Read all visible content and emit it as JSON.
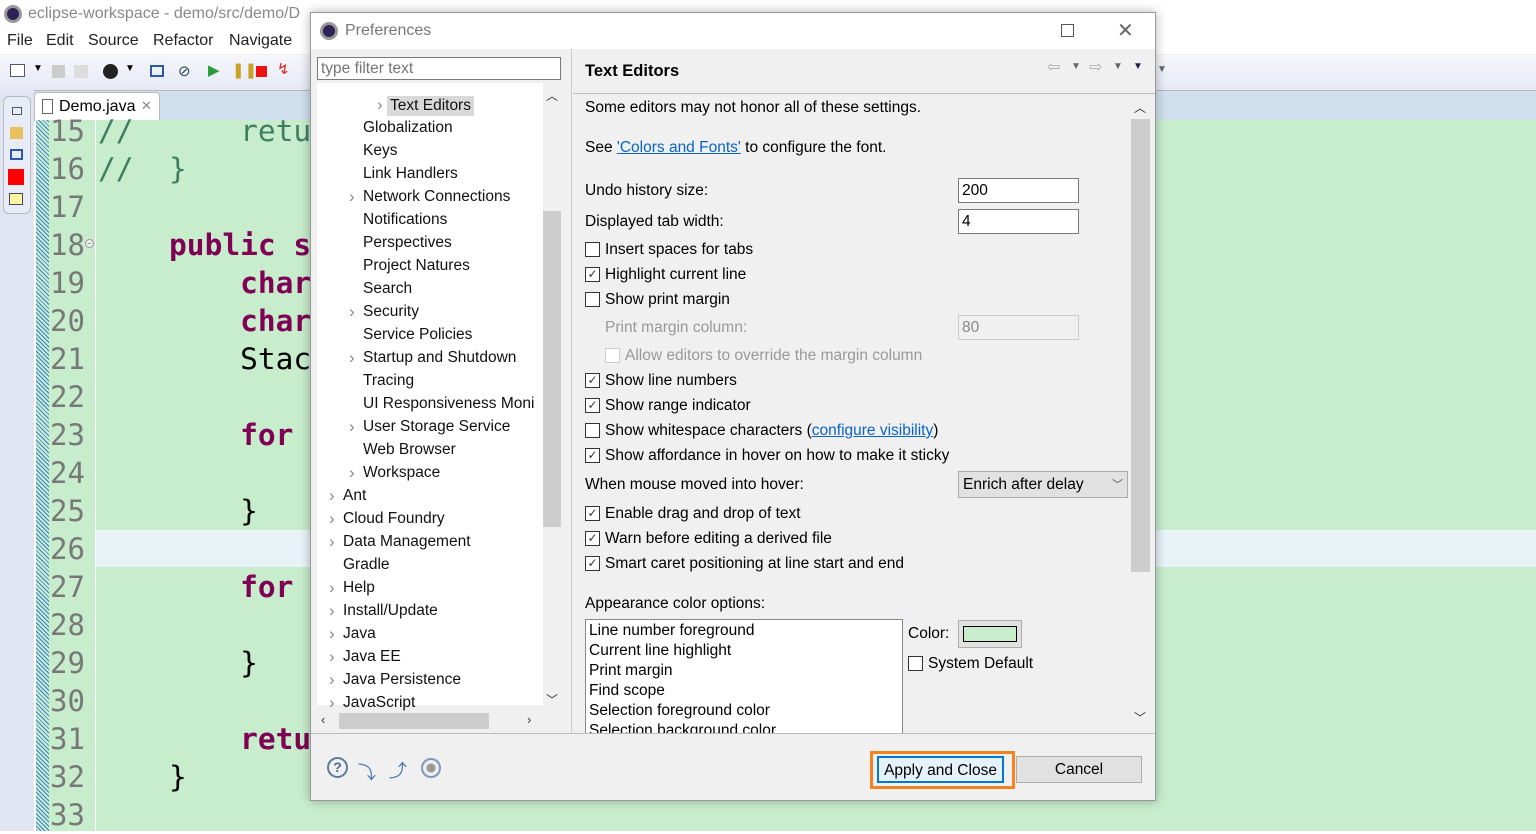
{
  "window": {
    "title": "eclipse-workspace - demo/src/demo/D"
  },
  "menu": [
    "File",
    "Edit",
    "Source",
    "Refactor",
    "Navigate"
  ],
  "editor": {
    "tab": "Demo.java",
    "line_numbers": [
      "15",
      "16",
      "17",
      "18",
      "19",
      "20",
      "21",
      "22",
      "23",
      "24",
      "25",
      "26",
      "27",
      "28",
      "29",
      "30",
      "31",
      "32",
      "33"
    ],
    "lines": [
      {
        "cm": "//      retu"
      },
      {
        "cm": "//  }"
      },
      {},
      {
        "kw": "    public s"
      },
      {
        "kw": "        char"
      },
      {
        "kw": "        char"
      },
      {
        "t": "        Stac"
      },
      {},
      {
        "kw": "        for"
      },
      {},
      {
        "t": "        }"
      },
      {},
      {
        "kw": "        for"
      },
      {},
      {
        "t": "        }"
      },
      {},
      {
        "kw": "        retu"
      },
      {
        "t": "    }"
      },
      {}
    ],
    "background": "#c7edcc"
  },
  "dialog": {
    "title": "Preferences",
    "filter_placeholder": "type filter text",
    "tree": [
      {
        "label": "Text Editors",
        "selected": true,
        "chev": true
      },
      {
        "label": "Globalization"
      },
      {
        "label": "Keys"
      },
      {
        "label": "Link Handlers"
      },
      {
        "label": "Network Connections",
        "chev": true
      },
      {
        "label": "Notifications"
      },
      {
        "label": "Perspectives"
      },
      {
        "label": "Project Natures"
      },
      {
        "label": "Search"
      },
      {
        "label": "Security",
        "chev": true
      },
      {
        "label": "Service Policies"
      },
      {
        "label": "Startup and Shutdown",
        "chev": true
      },
      {
        "label": "Tracing"
      },
      {
        "label": "UI Responsiveness Moni"
      },
      {
        "label": "User Storage Service",
        "chev": true
      },
      {
        "label": "Web Browser"
      },
      {
        "label": "Workspace",
        "chev": true
      },
      {
        "label": "Ant",
        "top": true,
        "chev": true
      },
      {
        "label": "Cloud Foundry",
        "top": true,
        "chev": true
      },
      {
        "label": "Data Management",
        "top": true,
        "chev": true
      },
      {
        "label": "Gradle",
        "top": true
      },
      {
        "label": "Help",
        "top": true,
        "chev": true
      },
      {
        "label": "Install/Update",
        "top": true,
        "chev": true
      },
      {
        "label": "Java",
        "top": true,
        "chev": true
      },
      {
        "label": "Java EE",
        "top": true,
        "chev": true
      },
      {
        "label": "Java Persistence",
        "top": true,
        "chev": true
      },
      {
        "label": "JavaScript",
        "top": true,
        "chev": true
      }
    ],
    "page": {
      "title": "Text Editors",
      "note": "Some editors may not honor all of these settings.",
      "see_prefix": "See ",
      "see_link": "'Colors and Fonts'",
      "see_suffix": " to configure the font.",
      "undo_label": "Undo history size:",
      "undo_value": "200",
      "tab_label": "Displayed tab width:",
      "tab_value": "4",
      "checks": [
        {
          "label": "Insert spaces for tabs",
          "checked": false
        },
        {
          "label": "Highlight current line",
          "checked": true
        },
        {
          "label": "Show print margin",
          "checked": false
        }
      ],
      "margin_label": "Print margin column:",
      "margin_value": "80",
      "override_label": "Allow editors to override the margin column",
      "checks2": [
        {
          "label": "Show line numbers",
          "checked": true
        },
        {
          "label": "Show range indicator",
          "checked": true
        },
        {
          "label": "Show whitespace characters (",
          "checked": false,
          "link": "configure visibility",
          "after": ")"
        },
        {
          "label": "Show affordance in hover on how to make it sticky",
          "checked": true
        }
      ],
      "hover_label": "When mouse moved into hover:",
      "hover_value": "Enrich after delay",
      "checks3": [
        {
          "label": "Enable drag and drop of text",
          "checked": true
        },
        {
          "label": "Warn before editing a derived file",
          "checked": true
        },
        {
          "label": "Smart caret positioning at line start and end",
          "checked": true
        }
      ],
      "appearance_label": "Appearance color options:",
      "appearance_items": [
        "Line number foreground",
        "Current line highlight",
        "Print margin",
        "Find scope",
        "Selection foreground color",
        "Selection background color"
      ],
      "color_label": "Color:",
      "color_value": "#c7edcc",
      "system_default": "System Default"
    },
    "apply_close": "Apply and Close",
    "cancel": "Cancel",
    "focus_color": "#f5821f"
  }
}
